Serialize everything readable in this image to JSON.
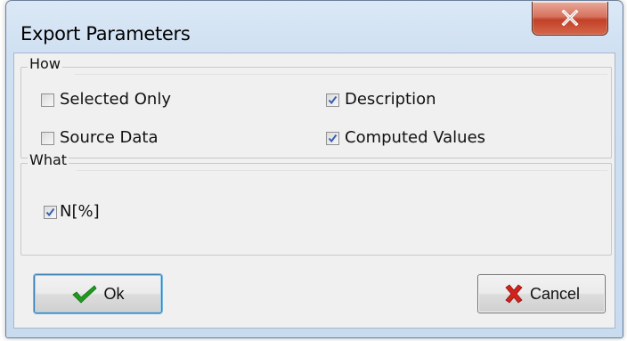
{
  "window": {
    "title": "Export Parameters"
  },
  "how": {
    "label": "How",
    "selected_only": {
      "label": "Selected Only",
      "checked": false
    },
    "source_data": {
      "label": "Source Data",
      "checked": false
    },
    "description": {
      "label": "Description",
      "checked": true
    },
    "computed_values": {
      "label": "Computed Values",
      "checked": true
    }
  },
  "what": {
    "label": "What",
    "n_percent": {
      "label": "N[%]",
      "checked": true
    }
  },
  "buttons": {
    "ok_label": "Ok",
    "cancel_label": "Cancel",
    "ok_icon": "green-checkmark-icon",
    "cancel_icon": "red-x-icon"
  },
  "colors": {
    "close_button": "#c9503a",
    "checkmark": "#3a5fb0",
    "ok_icon": "#1f9a1f",
    "cancel_icon": "#d2231b"
  }
}
